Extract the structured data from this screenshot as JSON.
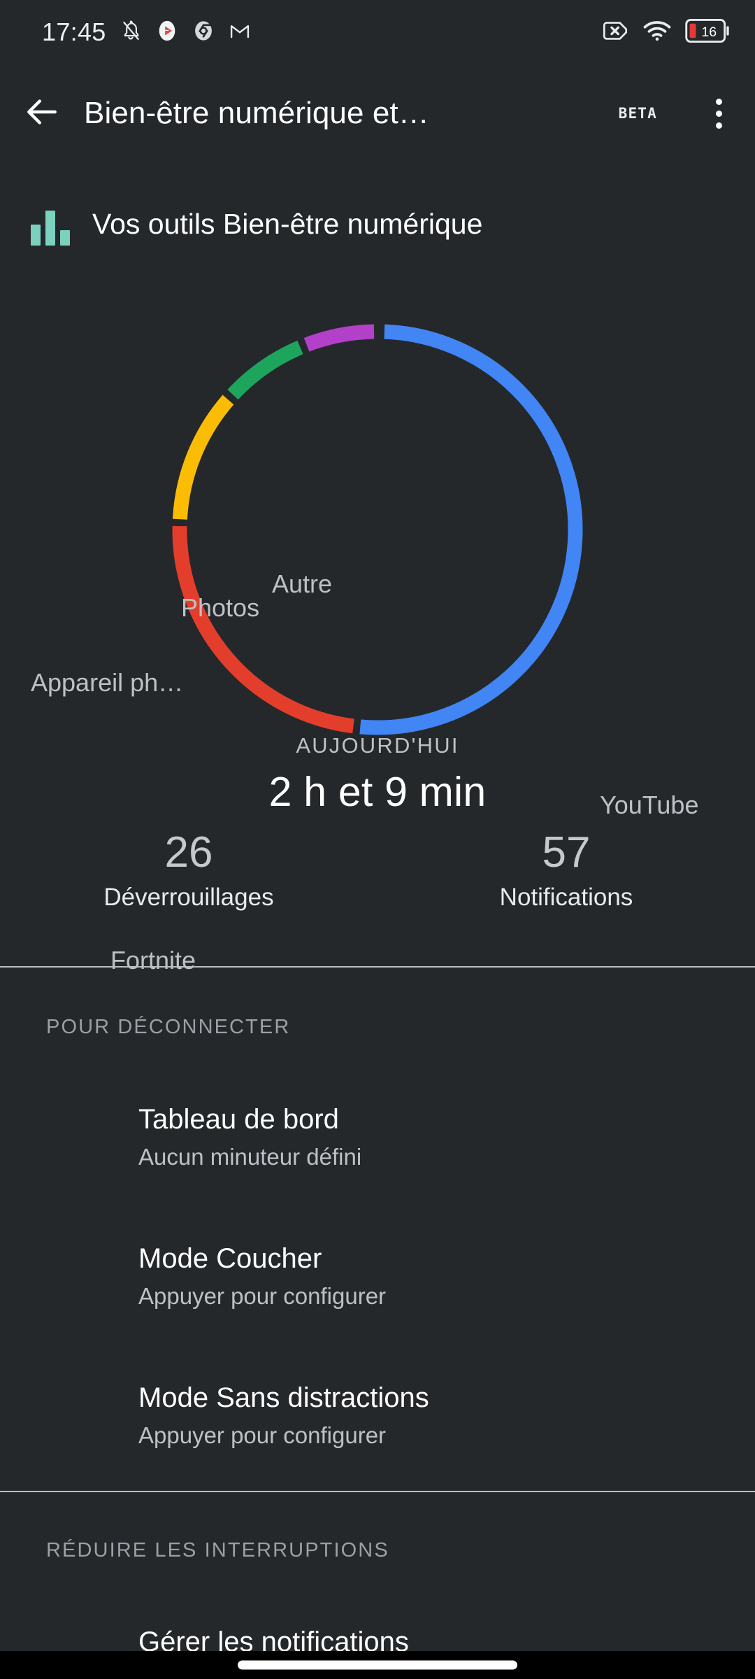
{
  "status_bar": {
    "time": "17:45",
    "left_icons": [
      "notifications-off-icon",
      "youtube-music-icon",
      "chrome-icon",
      "gmail-icon"
    ],
    "right_icons": [
      "sim-card-off-icon",
      "wifi-icon"
    ],
    "battery_level": "16"
  },
  "app_bar": {
    "back_icon": "back-arrow-icon",
    "title": "Bien-être numérique et…",
    "beta_label": "BETA",
    "overflow_icon": "more-vert-icon"
  },
  "tools_section": {
    "icon": "bar-chart-icon",
    "label": "Vos outils Bien-être numérique"
  },
  "chart_data": {
    "type": "pie",
    "title": "AUJOURD'HUI",
    "center_subtitle": "AUJOURD'HUI",
    "center_value": "2 h et 9 min",
    "total_minutes": 129,
    "labels": [
      "YouTube",
      "Fortnite",
      "Appareil ph…",
      "Photos",
      "Autre"
    ],
    "values": [
      65.5,
      31.3,
      13.6,
      8.9,
      7.7
    ],
    "units": "minutes",
    "colors": [
      "#4285f4",
      "#e33e2b",
      "#fbbc04",
      "#1ea55d",
      "#b340c9"
    ],
    "segments": [
      {
        "name": "YouTube",
        "label": "YouTube",
        "color": "#4285f4",
        "start_deg": 2,
        "end_deg": 185
      },
      {
        "name": "Fortnite",
        "label": "Fortnite",
        "color": "#e33e2b",
        "start_deg": 187,
        "end_deg": 271
      },
      {
        "name": "Appareil photo",
        "label": "Appareil ph…",
        "color": "#fbbc04",
        "start_deg": 273,
        "end_deg": 311
      },
      {
        "name": "Photos",
        "label": "Photos",
        "color": "#1ea55d",
        "start_deg": 313,
        "end_deg": 337
      },
      {
        "name": "Autre",
        "label": "Autre",
        "color": "#b340c9",
        "start_deg": 339,
        "end_deg": 359
      }
    ],
    "legend_position": "around-ring",
    "grid": false
  },
  "stats": [
    {
      "value": "26",
      "label": "Déverrouillages"
    },
    {
      "value": "57",
      "label": "Notifications"
    }
  ],
  "sections": [
    {
      "header": "POUR DÉCONNECTER",
      "items": [
        {
          "title": "Tableau de bord",
          "subtitle": "Aucun minuteur défini"
        },
        {
          "title": "Mode Coucher",
          "subtitle": "Appuyer pour configurer"
        },
        {
          "title": "Mode Sans distractions",
          "subtitle": "Appuyer pour configurer"
        }
      ]
    },
    {
      "header": "RÉDUIRE LES INTERRUPTIONS",
      "items": [
        {
          "title": "Gérer les notifications",
          "subtitle": ""
        }
      ]
    }
  ],
  "nav_bar": {
    "home_pill": "home-indicator"
  },
  "theme": {
    "background": "#24282b",
    "divider": "#babfc3",
    "accent_teal": "#7ad1bd",
    "text_primary": "#ffffff",
    "text_secondary": "#bdc1c6",
    "text_tertiary": "#9aa0a6",
    "battery_low": "#e53935"
  }
}
